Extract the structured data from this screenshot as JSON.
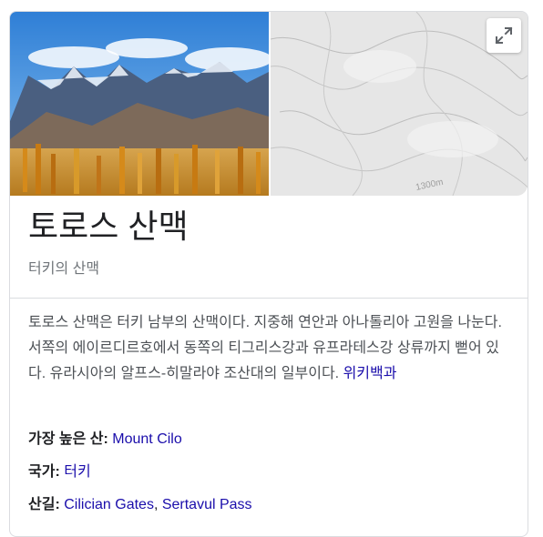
{
  "panel": {
    "title": "토로스 산맥",
    "subtitle": "터키의 산맥",
    "description": "토로스 산맥은 터키 남부의 산맥이다. 지중해 연안과 아나톨리아 고원을 나눈다. 서쪽의 에이르디르호에서 동쪽의 티그리스강과 유프라테스강 상류까지 뻗어 있다. 유라시아의 알프스-히말라야 조산대의 일부이다.",
    "source_link": "위키백과",
    "map_label": "1300m"
  },
  "facts": [
    {
      "label": "가장 높은 산:",
      "values": [
        "Mount Cilo"
      ]
    },
    {
      "label": "국가:",
      "values": [
        "터키"
      ]
    },
    {
      "label": "산길:",
      "values": [
        "Cilician Gates",
        "Sertavul Pass"
      ]
    }
  ],
  "colors": {
    "link": "#1a0dab",
    "title": "#202124",
    "subtitle": "#70757a",
    "body": "#4d5156",
    "border": "#dadce0"
  },
  "icons": {
    "expand": "expand-icon"
  }
}
